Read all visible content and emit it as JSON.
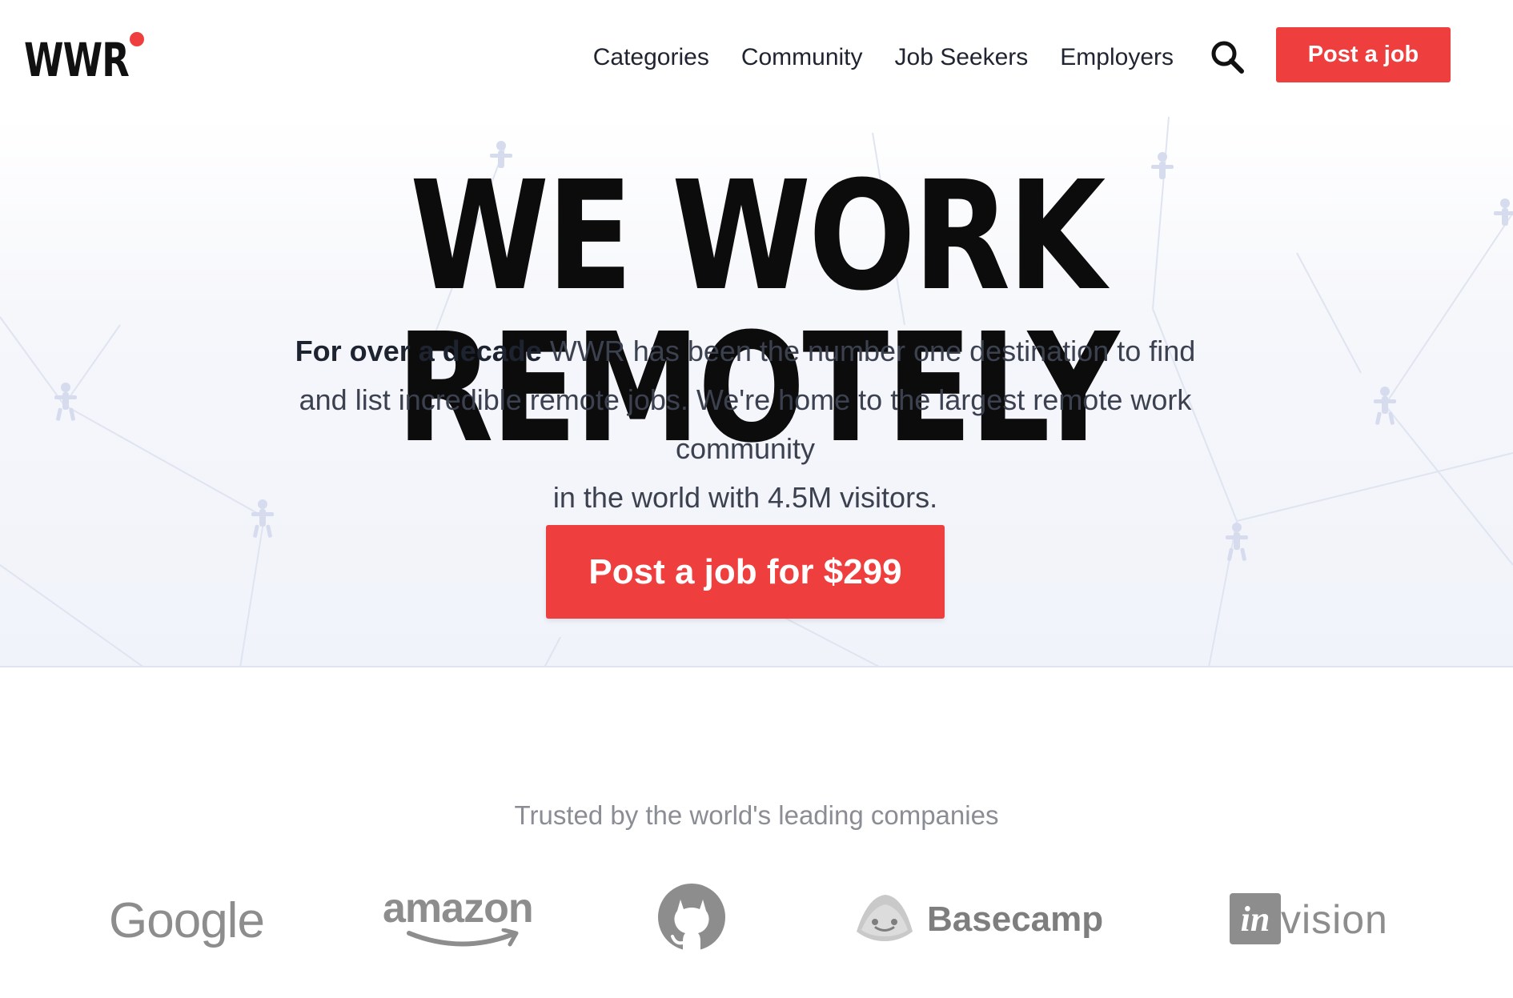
{
  "header": {
    "logo_text": "WWR",
    "nav": [
      "Categories",
      "Community",
      "Job Seekers",
      "Employers"
    ],
    "post_label": "Post a job"
  },
  "hero": {
    "title": "WE WORK REMOTELY",
    "desc_bold": "For over a decade",
    "desc_line1_rest": " WWR has been the number one destination to find",
    "desc_line2": "and list incredible remote jobs. We're home to the largest remote work",
    "desc_line3": "community",
    "desc_line4": "in the world with 4.5M visitors.",
    "cta_label": "Post a job for $299"
  },
  "trusted": {
    "heading": "Trusted by the world's leading companies",
    "companies": {
      "google": "Google",
      "amazon": "amazon",
      "basecamp": "Basecamp",
      "invision_box": "in",
      "invision_rest": "vision"
    }
  },
  "colors": {
    "accent": "#ef3e3e",
    "text_dark": "#0c0c0c",
    "logo_gray": "#8d8d8d"
  },
  "icons": {
    "search": "search-icon",
    "github": "github-icon",
    "basecamp": "basecamp-icon"
  }
}
